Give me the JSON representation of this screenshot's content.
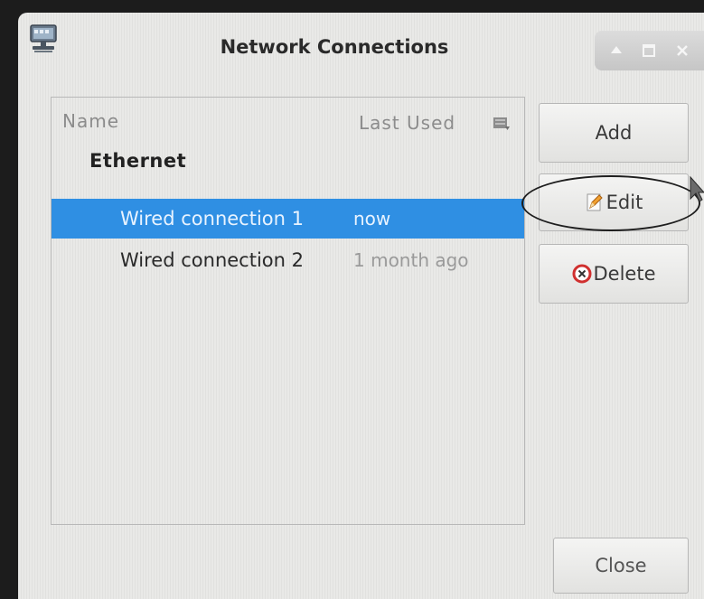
{
  "window": {
    "title": "Network Connections",
    "controls": [
      "up-icon",
      "maximize-icon",
      "close-x-icon"
    ]
  },
  "list": {
    "columns": {
      "name": "Name",
      "last_used": "Last Used"
    },
    "groups": [
      {
        "label": "Ethernet",
        "rows": [
          {
            "name": "Wired connection 1",
            "last_used": "now",
            "selected": true
          },
          {
            "name": "Wired connection 2",
            "last_used": "1 month ago",
            "selected": false
          }
        ]
      }
    ]
  },
  "actions": {
    "add": "Add",
    "edit": "Edit",
    "delete": "Delete",
    "close": "Close"
  },
  "colors": {
    "selection": "#2f8fe3",
    "window_bg": "#e9e9e7",
    "delete_icon": "#d0302f",
    "edit_icon": "#f0a030"
  }
}
